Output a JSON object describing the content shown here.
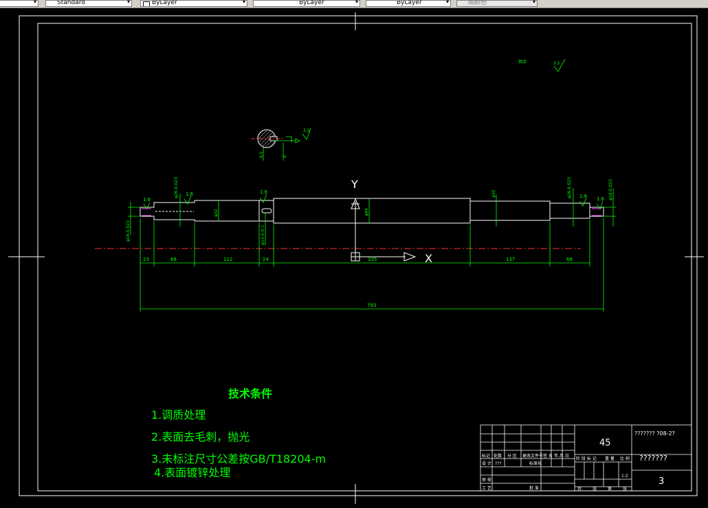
{
  "toolbar": {
    "text_style": "Standard",
    "layer_color": "ByLayer",
    "layer_linetype": "ByLayer",
    "layer_lineweight": "ByLayer",
    "plot_style": "随颜色"
  },
  "drawing": {
    "axis_y": "Y",
    "axis_x": "X",
    "roughness_top": "3.2",
    "roughness_top_label": "其余",
    "roughness_section": "3.2",
    "roughness_values": [
      "1.6",
      "1.6",
      "1.6",
      "1.6",
      "1.6"
    ],
    "dims_bottom": [
      "23",
      "68",
      "112",
      "24",
      "335",
      "137",
      "68"
    ],
    "dim_total": "793",
    "dia_labels": {
      "d1": "φ16-0.023",
      "d2": "φ26-0.023",
      "d3": "φ32",
      "d4": "φ44",
      "d5": "φ32",
      "d6": "φ26-0.023",
      "d7": "φ16-0.023",
      "key": "φ13.5-0.1",
      "sec1": "6.5",
      "sec2": "8"
    }
  },
  "notes": {
    "title": "技术条件",
    "items": [
      "1.调质处理",
      "2.表面去毛刺，抛光",
      "3.未标注尺寸公差按GB/T18204-m",
      "4.表面镀锌处理"
    ]
  },
  "title_block": {
    "material": "45",
    "drawing_no": "??????? ?08-2?",
    "part_name": "???????",
    "scale": "1:2",
    "sheet": "3",
    "header_row": [
      "标记",
      "处数",
      "分 区",
      "更改文件号",
      "签 名",
      "年.月.日"
    ],
    "design_row": [
      "设 计",
      "???",
      "标准化"
    ],
    "stage_row": [
      "阶 段 标 记",
      "重 量",
      "比 例"
    ],
    "review": "审 核",
    "process": "工 艺",
    "approve": "批 准",
    "footer_row": [
      "共",
      "张",
      "第",
      "张"
    ]
  }
}
